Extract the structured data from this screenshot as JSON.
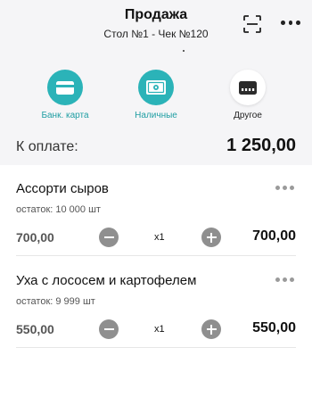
{
  "header": {
    "title": "Продажа",
    "subtitle": "Стол №1 - Чек №120",
    "scan_icon": "scan-icon",
    "more_icon": "more-dots-icon"
  },
  "payment_methods": [
    {
      "label": "Банк. карта",
      "icon": "card-icon",
      "style": "teal"
    },
    {
      "label": "Наличные",
      "icon": "cash-icon",
      "style": "teal"
    },
    {
      "label": "Другое",
      "icon": "wallet-icon",
      "style": "white"
    }
  ],
  "total": {
    "label": "К оплате:",
    "value": "1 250,00"
  },
  "items": [
    {
      "name": "Ассорти сыров",
      "stock": "остаток: 10 000 шт",
      "price": "700,00",
      "qty": "x1",
      "sum": "700,00"
    },
    {
      "name": "Уха с лососем и картофелем",
      "stock": "остаток: 9 999 шт",
      "price": "550,00",
      "qty": "x1",
      "sum": "550,00"
    }
  ],
  "colors": {
    "accent": "#2bb3b8",
    "accent_text": "#1f9ea3",
    "background_top": "#f5f5f7"
  }
}
